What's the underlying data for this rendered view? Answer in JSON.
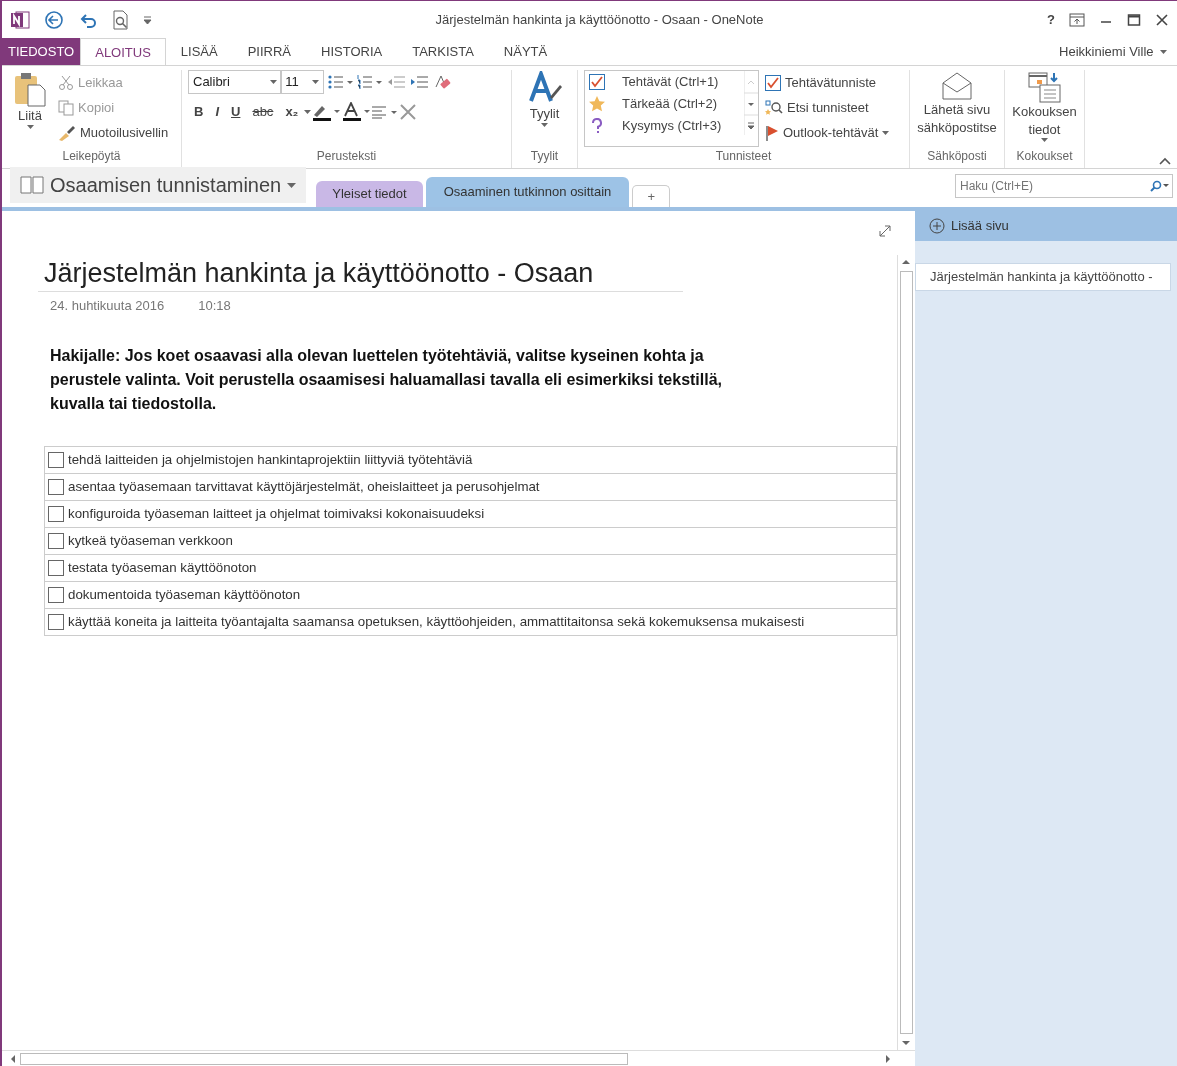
{
  "window": {
    "title": "Järjestelmän hankinta ja käyttöönotto - Osaan - OneNote",
    "help": "?",
    "user": "Heikkiniemi Ville"
  },
  "ribbon_tabs": [
    {
      "label": "TIEDOSTO",
      "kind": "file",
      "selected": false
    },
    {
      "label": "ALOITUS",
      "kind": "tab",
      "selected": true
    },
    {
      "label": "LISÄÄ",
      "kind": "tab",
      "selected": false
    },
    {
      "label": "PIIRRÄ",
      "kind": "tab",
      "selected": false
    },
    {
      "label": "HISTORIA",
      "kind": "tab",
      "selected": false
    },
    {
      "label": "TARKISTA",
      "kind": "tab",
      "selected": false
    },
    {
      "label": "NÄYTÄ",
      "kind": "tab",
      "selected": false
    }
  ],
  "clipboard": {
    "paste": "Liitä",
    "cut": {
      "label": "Leikkaa",
      "disabled": true
    },
    "copy": {
      "label": "Kopioi",
      "disabled": true
    },
    "painter": {
      "label": "Muotoilusivellin",
      "disabled": false
    },
    "group": "Leikepöytä"
  },
  "basic_text": {
    "font": "Calibri",
    "size": "11",
    "format_buttons": [
      "B",
      "I",
      "U",
      "abc",
      "x₂"
    ],
    "group": "Perusteksti"
  },
  "styles": {
    "label": "Tyylit",
    "group": "Tyylit"
  },
  "tags": {
    "items": [
      {
        "kind": "todo",
        "label": "Tehtävät (Ctrl+1)"
      },
      {
        "kind": "star",
        "label": "Tärkeää (Ctrl+2)"
      },
      {
        "kind": "question",
        "label": "Kysymys (Ctrl+3)"
      }
    ],
    "todo_tag": "Tehtävätunniste",
    "find_tags": "Etsi tunnisteet",
    "outlook": "Outlook-tehtävät",
    "group": "Tunnisteet"
  },
  "email": {
    "label": "Lähetä sivu sähköpostitse",
    "group": "Sähköposti"
  },
  "meetings": {
    "label": "Kokouksen tiedot",
    "group": "Kokoukset"
  },
  "notebook": {
    "name": "Osaamisen tunnistaminen",
    "sections": [
      {
        "label": "Yleiset tiedot",
        "selected": false,
        "color": "#c9b8e6"
      },
      {
        "label": "Osaaminen tutkinnon osittain",
        "selected": true,
        "color": "#9dc3e6"
      }
    ],
    "add_section": "+",
    "search": {
      "placeholder": "Haku (Ctrl+E)"
    }
  },
  "page": {
    "title": "Järjestelmän hankinta ja käyttöönotto - Osaan",
    "date": "24. huhtikuuta 2016",
    "time": "10:18",
    "intro": "Hakijalle: Jos koet osaavasi alla olevan luettelen työtehtäviä, valitse kyseinen kohta ja perustele valinta. Voit perustella osaamisesi haluamallasi tavalla eli esimerkiksi tekstillä, kuvalla tai tiedostolla.",
    "tasks": [
      {
        "text": "tehdä laitteiden ja ohjelmistojen hankintaprojektiin liittyviä työtehtäviä",
        "checked": false
      },
      {
        "text": "asentaa työasemaan tarvittavat käyttöjärjestelmät, oheislaitteet ja perusohjelmat",
        "checked": false
      },
      {
        "text": "konfiguroida työaseman laitteet ja ohjelmat toimivaksi kokonaisuudeksi",
        "checked": false
      },
      {
        "text": "kytkeä työaseman verkkoon",
        "checked": false
      },
      {
        "text": "testata työaseman käyttöönoton",
        "checked": false
      },
      {
        "text": "dokumentoida työaseman käyttöönoton",
        "checked": false
      },
      {
        "text": "käyttää koneita ja laitteita työantajalta saamansa opetuksen, käyttöohjeiden, ammattitaitonsa sekä kokemuksensa mukaisesti",
        "checked": false
      }
    ]
  },
  "pages_panel": {
    "add_page": "Lisää sivu",
    "pages": [
      {
        "title": "Järjestelmän hankinta ja käyttöönotto -",
        "selected": true
      }
    ]
  }
}
